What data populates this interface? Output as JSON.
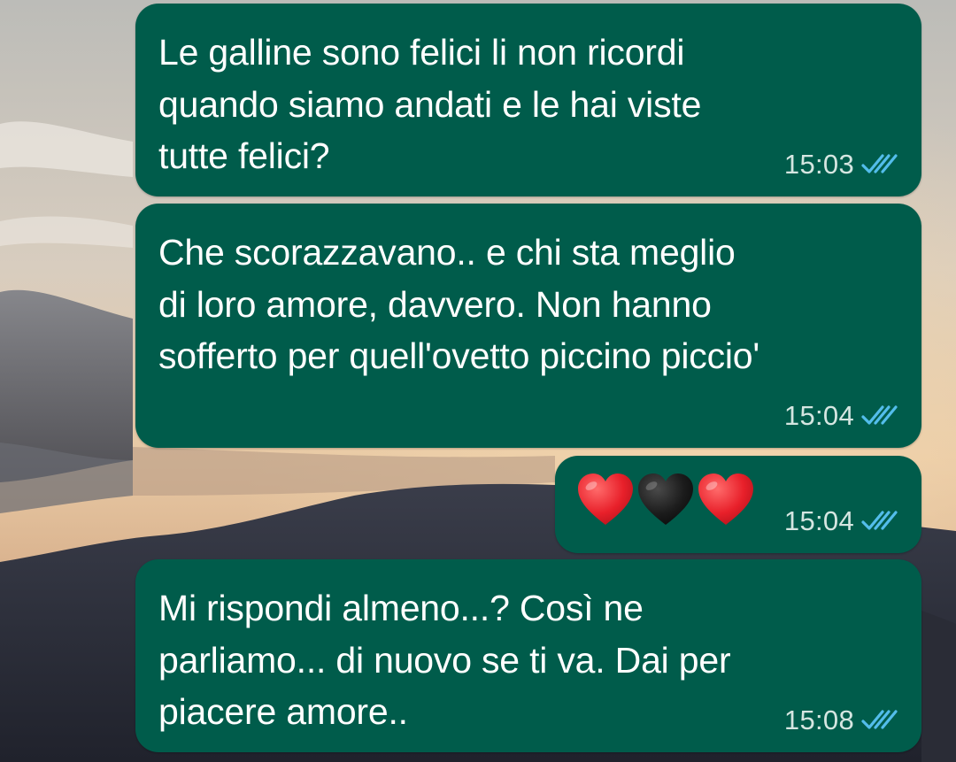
{
  "messages": [
    {
      "text": "Le galline sono felici li non ricordi\nquando siamo andati e le hai viste\ntutte felici?",
      "time": "15:03",
      "status": "read"
    },
    {
      "text": "Che scorazzavano.. e chi sta meglio\ndi loro amore, davvero. Non hanno\nsofferto per quell'ovetto piccino piccio'",
      "time": "15:04",
      "status": "read"
    },
    {
      "emoji": [
        "red-heart",
        "black-heart",
        "red-heart"
      ],
      "time": "15:04",
      "status": "read"
    },
    {
      "text": "Mi rispondi almeno...? Così ne\nparliamo... di nuovo se ti va. Dai per\npiacere amore..",
      "time": "15:08",
      "status": "read"
    }
  ],
  "colors": {
    "bubble": "#005c4b",
    "read_ticks": "#53bdeb",
    "text": "#ffffff",
    "time": "#d5e6e1"
  }
}
